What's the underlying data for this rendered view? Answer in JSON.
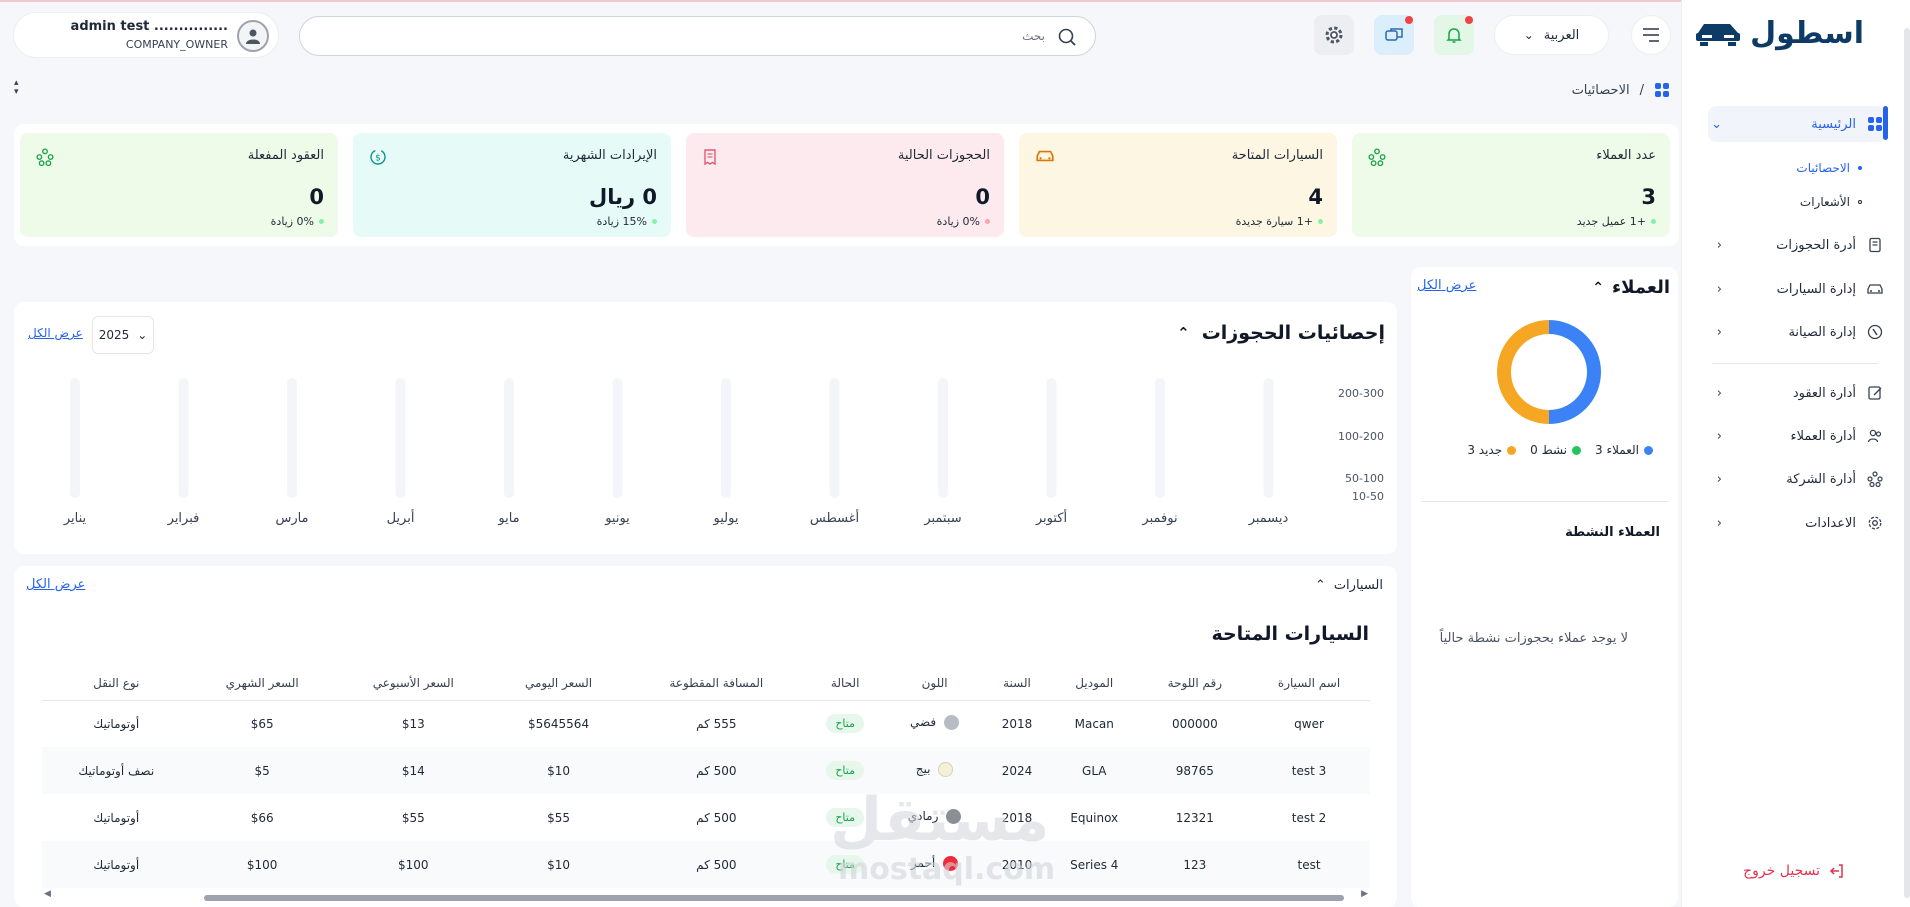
{
  "brand": {
    "name": "اسطول"
  },
  "sidebar": {
    "home": "الرئيسية",
    "sub": [
      "الاحصائيات",
      "الأشعارات"
    ],
    "items": [
      {
        "label": "أدرة الحجوزات",
        "icon": "document-icon"
      },
      {
        "label": "إدارة السيارات",
        "icon": "car-icon"
      },
      {
        "label": "إدارة الصيانة",
        "icon": "wrench-icon"
      },
      {
        "label": "أدارة العقود",
        "icon": "contract-icon"
      },
      {
        "label": "أدارة العملاء",
        "icon": "users-icon"
      },
      {
        "label": "أدارة الشركة",
        "icon": "network-icon"
      },
      {
        "label": "الاعدادات",
        "icon": "gear-icon"
      }
    ],
    "logout": "تسجيل خروج"
  },
  "header": {
    "user_name": "admin test ...............",
    "user_role": "COMPANY_OWNER",
    "search_placeholder": "بحث",
    "language": "العربية"
  },
  "breadcrumb": {
    "current": "الاحصائيات",
    "sep": "/"
  },
  "stats": [
    {
      "title": "عدد العملاء",
      "value": "3",
      "change": "+1 عميل جديد",
      "bg": "#eefbe9",
      "dot": "#86efac",
      "icon": "network-icon"
    },
    {
      "title": "السيارات المتاحة",
      "value": "4",
      "change": "+1 سيارة جديدة",
      "bg": "#fdf6e3",
      "dot": "#86efac",
      "icon": "car-icon"
    },
    {
      "title": "الحجوزات الحالية",
      "value": "0",
      "change": "0% زيادة",
      "bg": "#fdeaee",
      "dot": "#fca5a5",
      "icon": "receipt-icon"
    },
    {
      "title": "الإيرادات الشهرية",
      "value": "0 ريال",
      "change": "15% زيادة",
      "bg": "#e6fbf8",
      "dot": "#86efac",
      "icon": "dollar-icon"
    },
    {
      "title": "العقود المفعلة",
      "value": "0",
      "change": "0% زيادة",
      "bg": "#eefbe9",
      "dot": "#86efac",
      "icon": "network-icon"
    }
  ],
  "customers": {
    "title": "العملاء",
    "view_all": "عرض الكل",
    "legend": [
      {
        "label": "العملاء 3",
        "color": "#3b82f6"
      },
      {
        "label": "نشط 0",
        "color": "#22c55e"
      },
      {
        "label": "جديد 3",
        "color": "#f5a623"
      }
    ],
    "active_title": "العملاء النشطة",
    "empty": "لا يوجد عملاء بحجوزات نشطة حالياً"
  },
  "bookings": {
    "title": "إحصائيات الحجوزات",
    "year": "2025",
    "view_all": "عرض الكل"
  },
  "chart_data": [
    {
      "type": "pie",
      "categories": [
        "العملاء",
        "جديد"
      ],
      "values": [
        3,
        3
      ],
      "colors": [
        "#3b82f6",
        "#f5a623"
      ]
    },
    {
      "type": "bar",
      "categories": [
        "يناير",
        "فبراير",
        "مارس",
        "أبريل",
        "مايو",
        "يونيو",
        "يوليو",
        "أغسطس",
        "سبتمبر",
        "أكتوبر",
        "نوفمبر",
        "ديسمبر"
      ],
      "values": [
        0,
        0,
        0,
        0,
        0,
        0,
        0,
        0,
        0,
        0,
        0,
        0
      ],
      "ytick_labels": [
        "10-50",
        "50-100",
        "100-200",
        "200-300"
      ],
      "grid": false
    }
  ],
  "cars": {
    "section": "السيارات",
    "view_all": "عرض الكل",
    "title": "السيارات المتاحة",
    "columns": [
      "اسم السيارة",
      "رقم اللوحة",
      "الموديل",
      "السنة",
      "اللون",
      "الحالة",
      "المسافة المقطوعة",
      "السعر اليومي",
      "السعر الأسبوعي",
      "السعر الشهري",
      "نوع النقل"
    ],
    "rows": [
      [
        "qwer",
        "000000",
        "Macan",
        "2018",
        "فضي",
        "متاح",
        "555 كم",
        "$5645564",
        "$13",
        "$65",
        "أوتوماتيك"
      ],
      [
        "test 3",
        "98765",
        "GLA",
        "2024",
        "بيج",
        "متاح",
        "500 كم",
        "$10",
        "$14",
        "$5",
        "نصف أوتوماتيك"
      ],
      [
        "test 2",
        "12321",
        "Equinox",
        "2018",
        "رمادي",
        "متاح",
        "500 كم",
        "$55",
        "$55",
        "$66",
        "أوتوماتيك"
      ],
      [
        "test",
        "123",
        "Series 4",
        "2010",
        "أحمر",
        "متاح",
        "500 كم",
        "$10",
        "$100",
        "$100",
        "أوتوماتيك"
      ]
    ],
    "row_colors": [
      "#b7bcc4",
      "#f4f1d8",
      "#8a8f96",
      "#ef2b3a"
    ]
  },
  "watermark": {
    "ar": "مستقل",
    "en": "mostaql.com"
  }
}
